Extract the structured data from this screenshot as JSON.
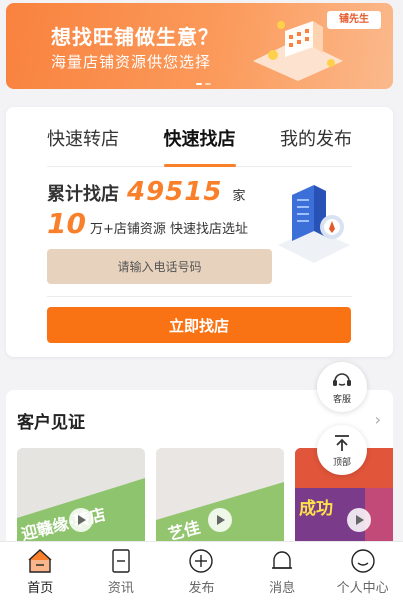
{
  "banner": {
    "headline": "想找旺铺做生意？",
    "subline": "海量店铺资源供您选择",
    "logo": "铺先生"
  },
  "tabs": [
    {
      "label": "快速转店",
      "active": false
    },
    {
      "label": "快速找店",
      "active": true
    },
    {
      "label": "我的发布",
      "active": false
    }
  ],
  "stats": {
    "total_label": "累计找店",
    "total_value": "49515",
    "total_unit": "家",
    "resources_value": "10",
    "resources_text": "万+店铺资源 快速找店选址"
  },
  "phone_input": {
    "placeholder": "请输入电话号码",
    "value": ""
  },
  "find_button": "立即找店",
  "testimonials": {
    "title": "客户见证",
    "videos": [
      {
        "caption": "迎赣缘·转店"
      },
      {
        "caption": "艺佳"
      },
      {
        "caption": "成功"
      }
    ]
  },
  "floating": {
    "service_label": "客服",
    "top_label": "顶部"
  },
  "nav": [
    {
      "label": "首页",
      "icon": "home-icon",
      "active": true
    },
    {
      "label": "资讯",
      "icon": "news-icon",
      "active": false
    },
    {
      "label": "发布",
      "icon": "publish-icon",
      "active": false
    },
    {
      "label": "消息",
      "icon": "bell-icon",
      "active": false
    },
    {
      "label": "个人中心",
      "icon": "user-icon",
      "active": false
    }
  ],
  "colors": {
    "accent": "#f97f2b",
    "button": "#f97314",
    "input_bg": "#e7d2bd"
  }
}
